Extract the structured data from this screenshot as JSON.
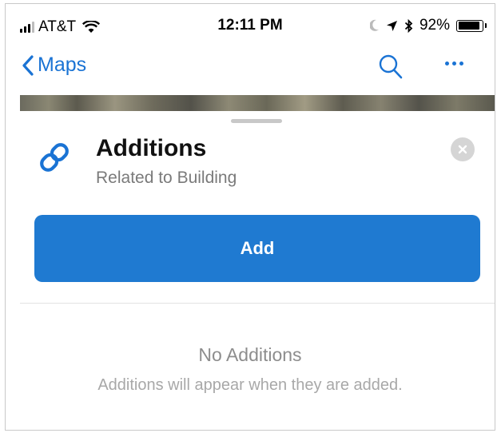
{
  "status_bar": {
    "carrier": "AT&T",
    "time": "12:11 PM",
    "battery_text": "92%",
    "battery_level": 0.92
  },
  "nav": {
    "back_label": "Maps",
    "accent_color": "#1a73d4"
  },
  "panel": {
    "title": "Additions",
    "subtitle": "Related to Building",
    "icon": "link-icon",
    "add_button_label": "Add",
    "empty_title": "No Additions",
    "empty_message": "Additions will appear when they are added."
  },
  "colors": {
    "accent": "#1a73d4",
    "button": "#1f7ad1"
  }
}
